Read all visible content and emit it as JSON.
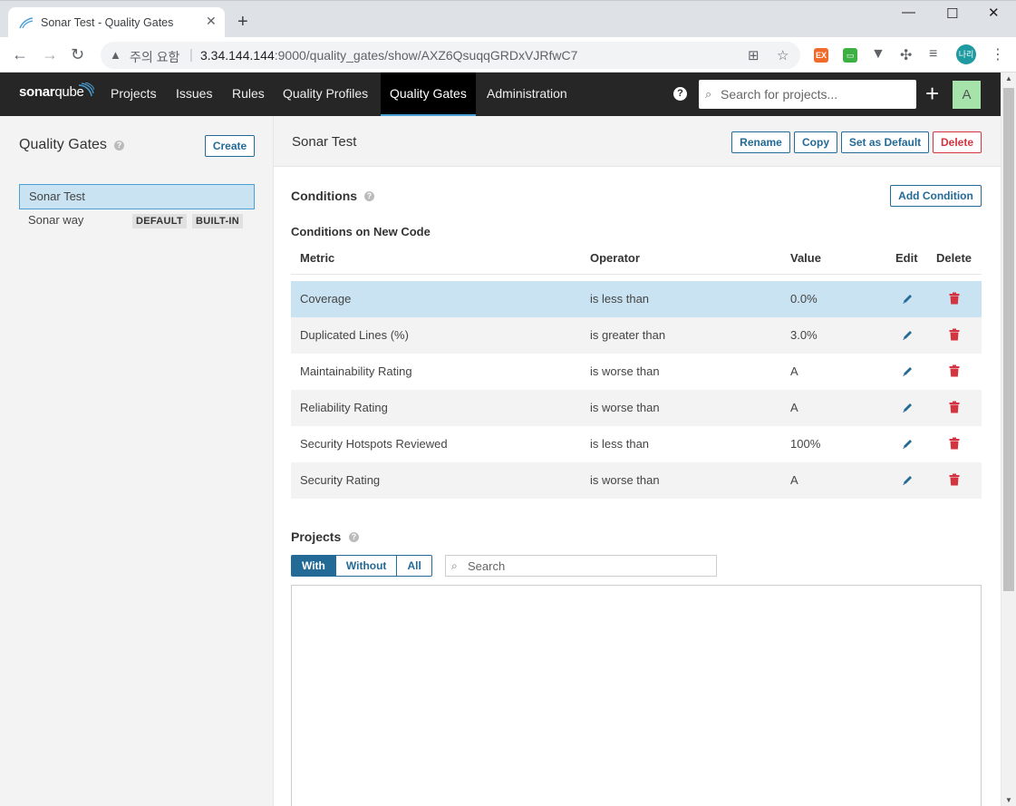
{
  "browser": {
    "tab_title": "Sonar Test - Quality Gates",
    "not_secure_label": "주의 요함",
    "url_host": "3.34.144.144",
    "url_rest": ":9000/quality_gates/show/AXZ6QsuqqGRDxVJRfwC7",
    "profile_initials": "나리",
    "ext_label": "EX"
  },
  "nav": {
    "logo_bold": "sonar",
    "logo_light": "qube",
    "items": [
      {
        "label": "Projects"
      },
      {
        "label": "Issues"
      },
      {
        "label": "Rules"
      },
      {
        "label": "Quality Profiles"
      },
      {
        "label": "Quality Gates"
      },
      {
        "label": "Administration"
      }
    ],
    "search_placeholder": "Search for projects...",
    "user_initial": "A"
  },
  "sidebar": {
    "title": "Quality Gates",
    "create_label": "Create",
    "gates": [
      {
        "name": "Sonar Test"
      },
      {
        "name": "Sonar way",
        "badges": [
          "DEFAULT",
          "BUILT-IN"
        ]
      }
    ]
  },
  "main": {
    "title": "Sonar Test",
    "actions": {
      "rename": "Rename",
      "copy": "Copy",
      "set_default": "Set as Default",
      "delete": "Delete"
    },
    "conditions_title": "Conditions",
    "add_condition_label": "Add Condition",
    "new_code_title": "Conditions on New Code",
    "columns": {
      "metric": "Metric",
      "operator": "Operator",
      "value": "Value",
      "edit": "Edit",
      "delete": "Delete"
    },
    "conditions": [
      {
        "metric": "Coverage",
        "operator": "is less than",
        "value": "0.0%"
      },
      {
        "metric": "Duplicated Lines (%)",
        "operator": "is greater than",
        "value": "3.0%"
      },
      {
        "metric": "Maintainability Rating",
        "operator": "is worse than",
        "value": "A"
      },
      {
        "metric": "Reliability Rating",
        "operator": "is worse than",
        "value": "A"
      },
      {
        "metric": "Security Hotspots Reviewed",
        "operator": "is less than",
        "value": "100%"
      },
      {
        "metric": "Security Rating",
        "operator": "is worse than",
        "value": "A"
      }
    ],
    "projects_title": "Projects",
    "filters": {
      "with": "With",
      "without": "Without",
      "all": "All"
    },
    "project_search_placeholder": "Search"
  },
  "colors": {
    "accent": "#236a97",
    "danger": "#d4333f",
    "selected_bg": "#cae3f2",
    "nav_bg": "#262626"
  }
}
